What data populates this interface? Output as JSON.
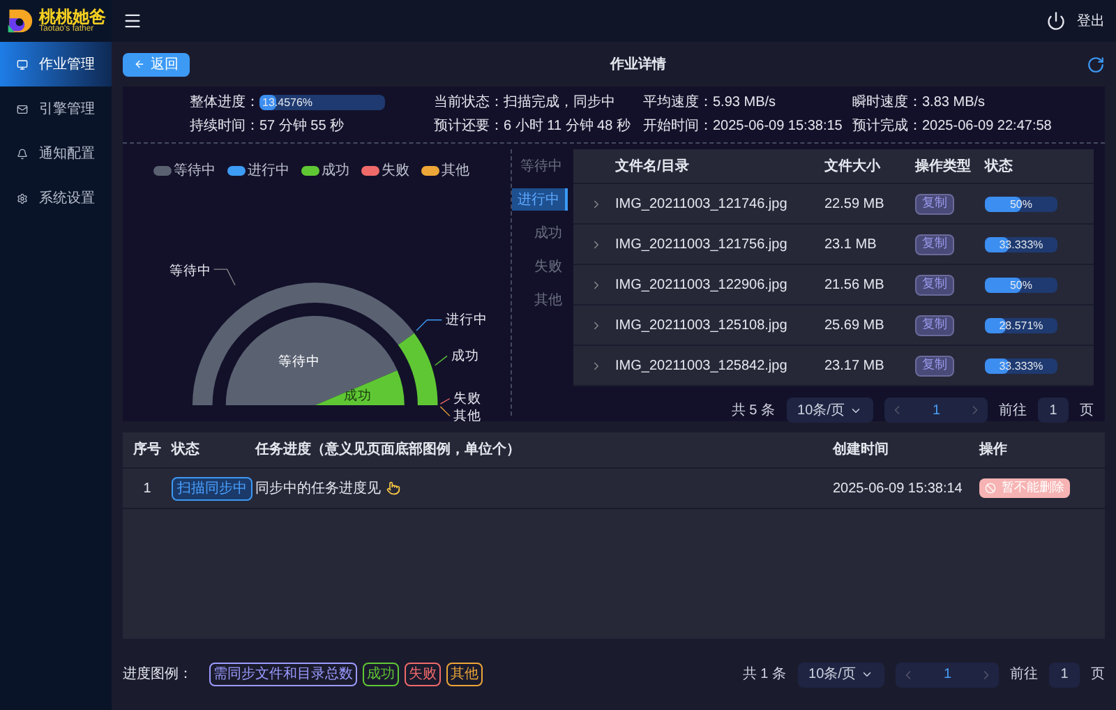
{
  "logo": {
    "title": "桃桃她爸",
    "subtitle": "Taotao's father"
  },
  "top_bar": {
    "logout": "登出"
  },
  "sidebar": {
    "items": [
      {
        "label": "作业管理",
        "selected": true
      },
      {
        "label": "引擎管理",
        "selected": false
      },
      {
        "label": "通知配置",
        "selected": false
      },
      {
        "label": "系统设置",
        "selected": false
      }
    ]
  },
  "header": {
    "back": "返回",
    "title": "作业详情"
  },
  "stats": [
    {
      "label": "整体进度：",
      "kind": "progress",
      "value": "13.4576%",
      "level": 0.134576
    },
    {
      "label": "当前状态：",
      "kind": "text",
      "value": "扫描完成，同步中"
    },
    {
      "label": "平均速度：",
      "kind": "text",
      "value": "5.93 MB/s"
    },
    {
      "label": "瞬时速度：",
      "kind": "text",
      "value": "3.83 MB/s"
    },
    {
      "label": "持续时间：",
      "kind": "text",
      "value": "57 分钟 55 秒"
    },
    {
      "label": "预计还要：",
      "kind": "text",
      "value": "6 小时 11 分钟 48 秒"
    },
    {
      "label": "开始时间：",
      "kind": "text",
      "value": "2025-06-09 15:38:15"
    },
    {
      "label": "预计完成：",
      "kind": "text",
      "value": "2025-06-09 22:47:58"
    }
  ],
  "chart": {
    "legend": [
      {
        "name": "等待中",
        "color": "#5a6272"
      },
      {
        "name": "进行中",
        "color": "#3d9cf5"
      },
      {
        "name": "成功",
        "color": "#5fc734"
      },
      {
        "name": "失败",
        "color": "#f06a6a"
      },
      {
        "name": "其他",
        "color": "#eda637"
      }
    ],
    "outer_labels": [
      "等待中",
      "进行中",
      "成功",
      "失败",
      "其他"
    ],
    "inner_labels": [
      "等待中",
      "成功"
    ]
  },
  "status_tabs": [
    {
      "label": "等待中",
      "selected": false
    },
    {
      "label": "进行中",
      "selected": true
    },
    {
      "label": "成功",
      "selected": false
    },
    {
      "label": "失败",
      "selected": false
    },
    {
      "label": "其他",
      "selected": false
    }
  ],
  "file_table": {
    "columns": [
      "文件名/目录",
      "文件大小",
      "操作类型",
      "状态"
    ],
    "rows": [
      {
        "name": "IMG_20211003_121746.jpg",
        "size": "22.59 MB",
        "op": "复制",
        "progress": "50%",
        "level": 0.5
      },
      {
        "name": "IMG_20211003_121756.jpg",
        "size": "23.1 MB",
        "op": "复制",
        "progress": "33.333%",
        "level": 0.33333
      },
      {
        "name": "IMG_20211003_122906.jpg",
        "size": "21.56 MB",
        "op": "复制",
        "progress": "50%",
        "level": 0.5
      },
      {
        "name": "IMG_20211003_125108.jpg",
        "size": "25.69 MB",
        "op": "复制",
        "progress": "28.571%",
        "level": 0.28571
      },
      {
        "name": "IMG_20211003_125842.jpg",
        "size": "23.17 MB",
        "op": "复制",
        "progress": "33.333%",
        "level": 0.33333
      }
    ],
    "pagination": {
      "total": "共 5 条",
      "page_size": "10条/页",
      "page": "1",
      "goto": "前往",
      "goto_value": "1",
      "unit": "页"
    }
  },
  "task_table": {
    "columns": [
      "序号",
      "状态",
      "任务进度（意义见页面底部图例，单位个）",
      "创建时间",
      "操作"
    ],
    "rows": [
      {
        "index": "1",
        "status": "扫描同步中",
        "progress": "同步中的任务进度见",
        "created": "2025-06-09 15:38:14",
        "action": "暂不能删除"
      }
    ]
  },
  "footer": {
    "legend_label": "进度图例：",
    "tags": [
      {
        "text": "需同步文件和目录总数",
        "color": "#9b9bff"
      },
      {
        "text": "成功",
        "color": "#5fc734"
      },
      {
        "text": "失败",
        "color": "#f06a6a"
      },
      {
        "text": "其他",
        "color": "#eda637"
      }
    ],
    "pagination": {
      "total": "共 1 条",
      "page_size": "10条/页",
      "page": "1",
      "goto": "前往",
      "goto_value": "1",
      "unit": "页"
    }
  }
}
